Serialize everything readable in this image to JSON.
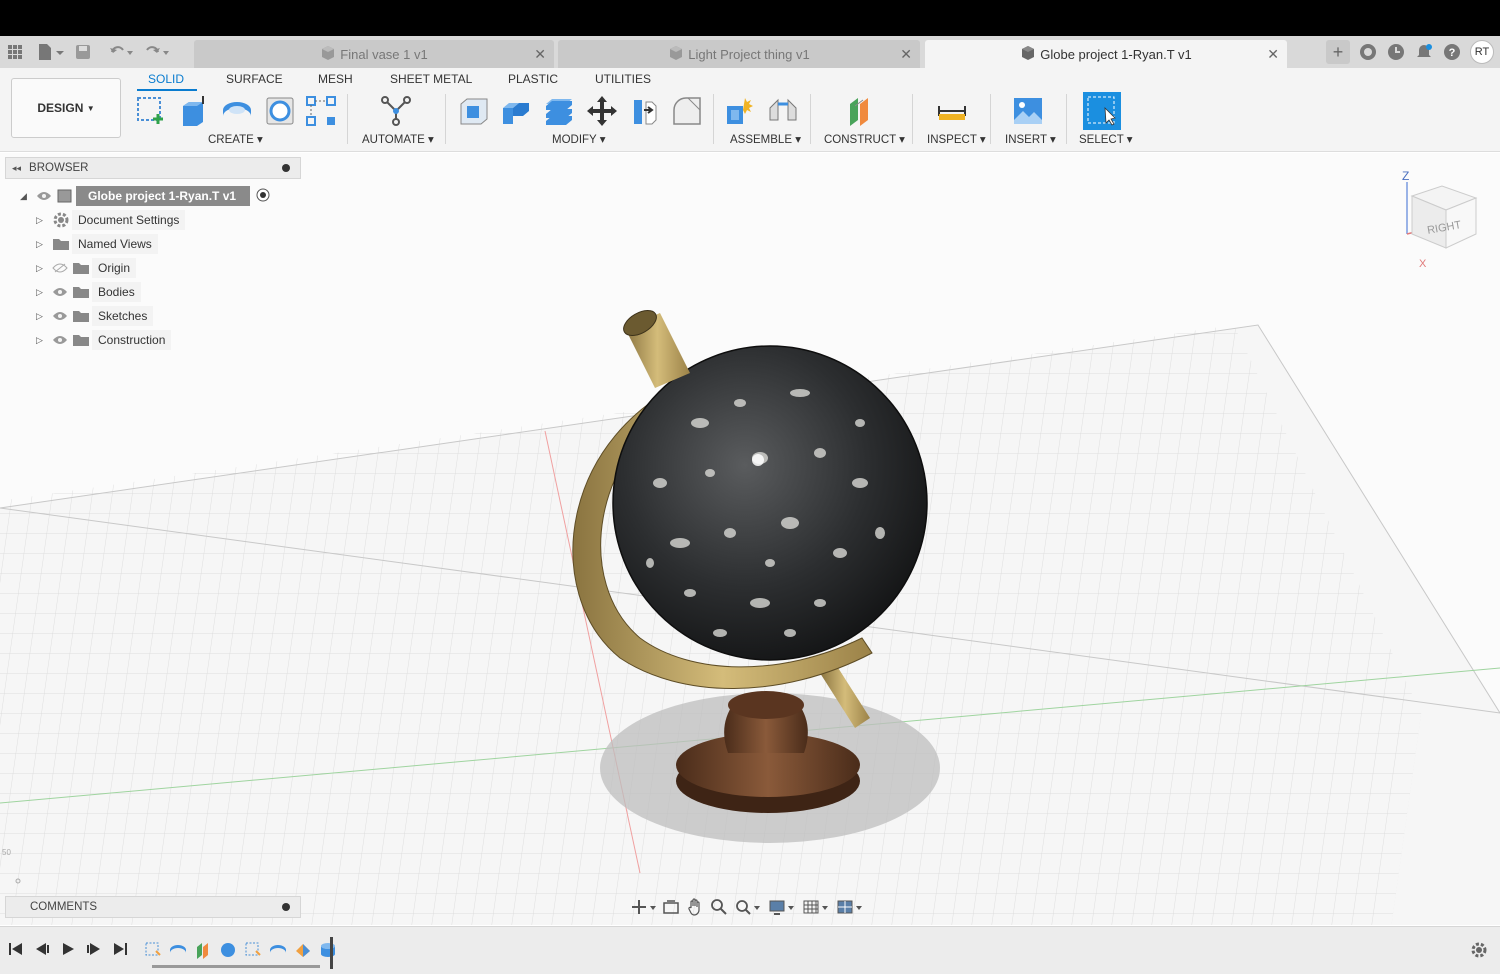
{
  "tabs": [
    {
      "label": "Final vase 1 v1",
      "active": false
    },
    {
      "label": "Light Project thing v1",
      "active": false
    },
    {
      "label": "Globe project 1-Ryan.T v1",
      "active": true
    }
  ],
  "user": {
    "initials": "RT"
  },
  "toolbar": {
    "workspace": "DESIGN",
    "tabs": [
      "SOLID",
      "SURFACE",
      "MESH",
      "SHEET METAL",
      "PLASTIC",
      "UTILITIES"
    ],
    "active_tab": "SOLID",
    "groups": {
      "create": "CREATE",
      "automate": "AUTOMATE",
      "modify": "MODIFY",
      "assemble": "ASSEMBLE",
      "construct": "CONSTRUCT",
      "inspect": "INSPECT",
      "insert": "INSERT",
      "select": "SELECT"
    },
    "accent_color": "#0a7ccf"
  },
  "browser": {
    "title": "BROWSER",
    "root": "Globe project 1-Ryan.T v1",
    "items": [
      {
        "label": "Document Settings",
        "icon": "gear-icon"
      },
      {
        "label": "Named Views",
        "icon": "folder-icon"
      },
      {
        "label": "Origin",
        "icon": "folder-icon",
        "hidden": true
      },
      {
        "label": "Bodies",
        "icon": "folder-icon"
      },
      {
        "label": "Sketches",
        "icon": "folder-icon"
      },
      {
        "label": "Construction",
        "icon": "folder-icon"
      }
    ]
  },
  "comments": {
    "title": "COMMENTS"
  },
  "viewcube": {
    "face": "RIGHT",
    "axis_z": "Z",
    "axis_x": "X"
  }
}
